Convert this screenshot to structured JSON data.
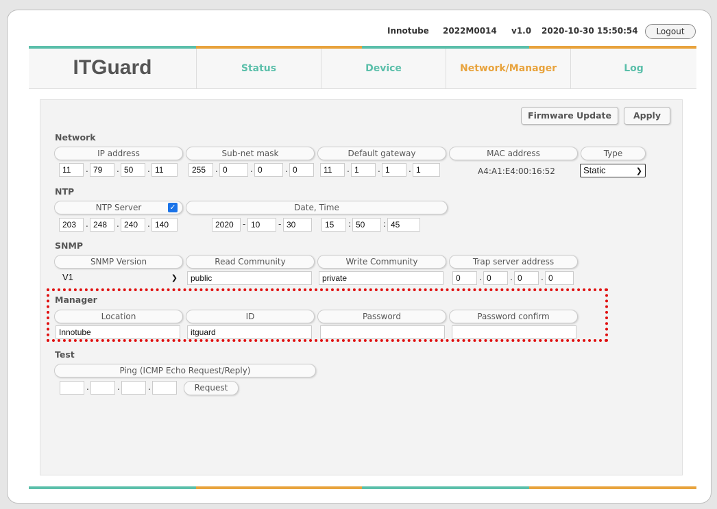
{
  "header": {
    "company": "Innotube",
    "serial": "2022M0014",
    "version": "v1.0",
    "datetime": "2020-10-30 15:50:54",
    "logout_label": "Logout"
  },
  "nav": {
    "logo": "ITGuard",
    "items": [
      "Status",
      "Device",
      "Network/Manager",
      "Log"
    ],
    "active": "Network/Manager"
  },
  "colors": {
    "teal": "#5bbfaa",
    "orange": "#e8a33d",
    "highlight_red": "#e01010"
  },
  "toolbar": {
    "firmware_label": "Firmware Update",
    "apply_label": "Apply"
  },
  "network": {
    "title": "Network",
    "headers": [
      "IP address",
      "Sub-net mask",
      "Default gateway",
      "MAC address",
      "Type"
    ],
    "ip": [
      "11",
      "79",
      "50",
      "11"
    ],
    "subnet": [
      "255",
      "0",
      "0",
      "0"
    ],
    "gateway": [
      "11",
      "1",
      "1",
      "1"
    ],
    "mac": "A4:A1:E4:00:16:52",
    "type": "Static"
  },
  "ntp": {
    "title": "NTP",
    "server_header": "NTP Server",
    "server_enabled": true,
    "datetime_header": "Date, Time",
    "server_ip": [
      "203",
      "248",
      "240",
      "140"
    ],
    "date": [
      "2020",
      "10",
      "30"
    ],
    "time": [
      "15",
      "50",
      "45"
    ]
  },
  "snmp": {
    "title": "SNMP",
    "headers": [
      "SNMP Version",
      "Read Community",
      "Write Community",
      "Trap server address"
    ],
    "version": "V1",
    "read_community": "public",
    "write_community": "private",
    "trap_ip": [
      "0",
      "0",
      "0",
      "0"
    ]
  },
  "manager": {
    "title": "Manager",
    "headers": [
      "Location",
      "ID",
      "Password",
      "Password confirm"
    ],
    "location": "Innotube",
    "id": "itguard",
    "password": "",
    "password_confirm": ""
  },
  "test": {
    "title": "Test",
    "ping_header": "Ping (ICMP Echo Request/Reply)",
    "ping_ip": [
      "",
      "",
      "",
      ""
    ],
    "request_label": "Request"
  }
}
